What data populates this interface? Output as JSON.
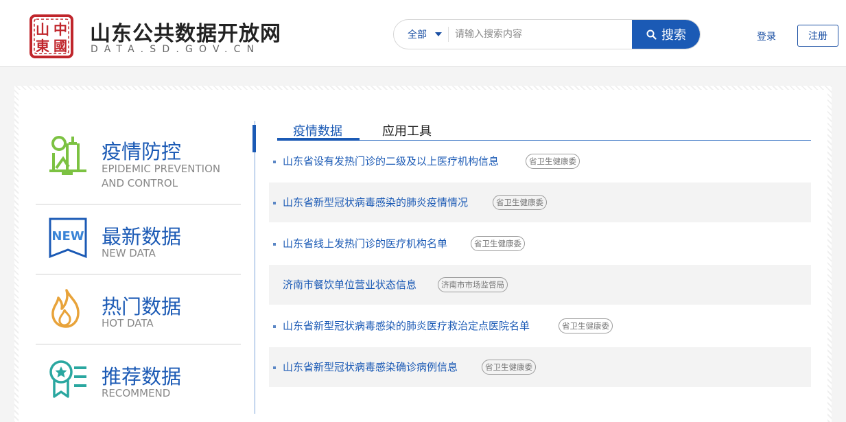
{
  "brand": {
    "title": "山东公共数据开放网",
    "subtitle": "DATA.SD.GOV.CN",
    "seal_chars": [
      "中",
      "國",
      "山",
      "東"
    ]
  },
  "search": {
    "scope_label": "全部",
    "placeholder": "请输入搜索内容",
    "value": "",
    "button_label": "搜索"
  },
  "auth": {
    "login_label": "登录",
    "register_label": "注册"
  },
  "nav": {
    "items": [
      {
        "cn": "疫情防控",
        "en_line1": "EPIDEMIC PREVENTION",
        "en_line2": "AND CONTROL",
        "icon": "epidemic-icon"
      },
      {
        "cn": "最新数据",
        "en_line1": "NEW DATA",
        "icon_text": "NEW",
        "icon": "new-badge-icon"
      },
      {
        "cn": "热门数据",
        "en_line1": "HOT DATA",
        "icon": "flame-icon"
      },
      {
        "cn": "推荐数据",
        "en_line1": "RECOMMEND",
        "icon": "award-list-icon"
      }
    ]
  },
  "tabs": [
    {
      "label": "疫情数据",
      "active": true
    },
    {
      "label": "应用工具",
      "active": false
    }
  ],
  "list": [
    {
      "title": "山东省设有发热门诊的二级及以上医疗机构信息",
      "tag": "省卫生健康委"
    },
    {
      "title": "山东省新型冠状病毒感染的肺炎疫情情况",
      "tag": "省卫生健康委"
    },
    {
      "title": "山东省线上发热门诊的医疗机构名单",
      "tag": "省卫生健康委"
    },
    {
      "title": "济南市餐饮单位营业状态信息",
      "tag": "济南市市场监督局"
    },
    {
      "title": "山东省新型冠状病毒感染的肺炎医疗救治定点医院名单",
      "tag": "省卫生健康委"
    },
    {
      "title": "山东省新型冠状病毒感染确诊病例信息",
      "tag": "省卫生健康委"
    }
  ],
  "colors": {
    "primary": "#1b5ab5",
    "seal_red": "#c0262c",
    "epidemic_green": "#7cc242",
    "flame_orange": "#e8a33a",
    "recommend_teal": "#2aa7a0"
  }
}
